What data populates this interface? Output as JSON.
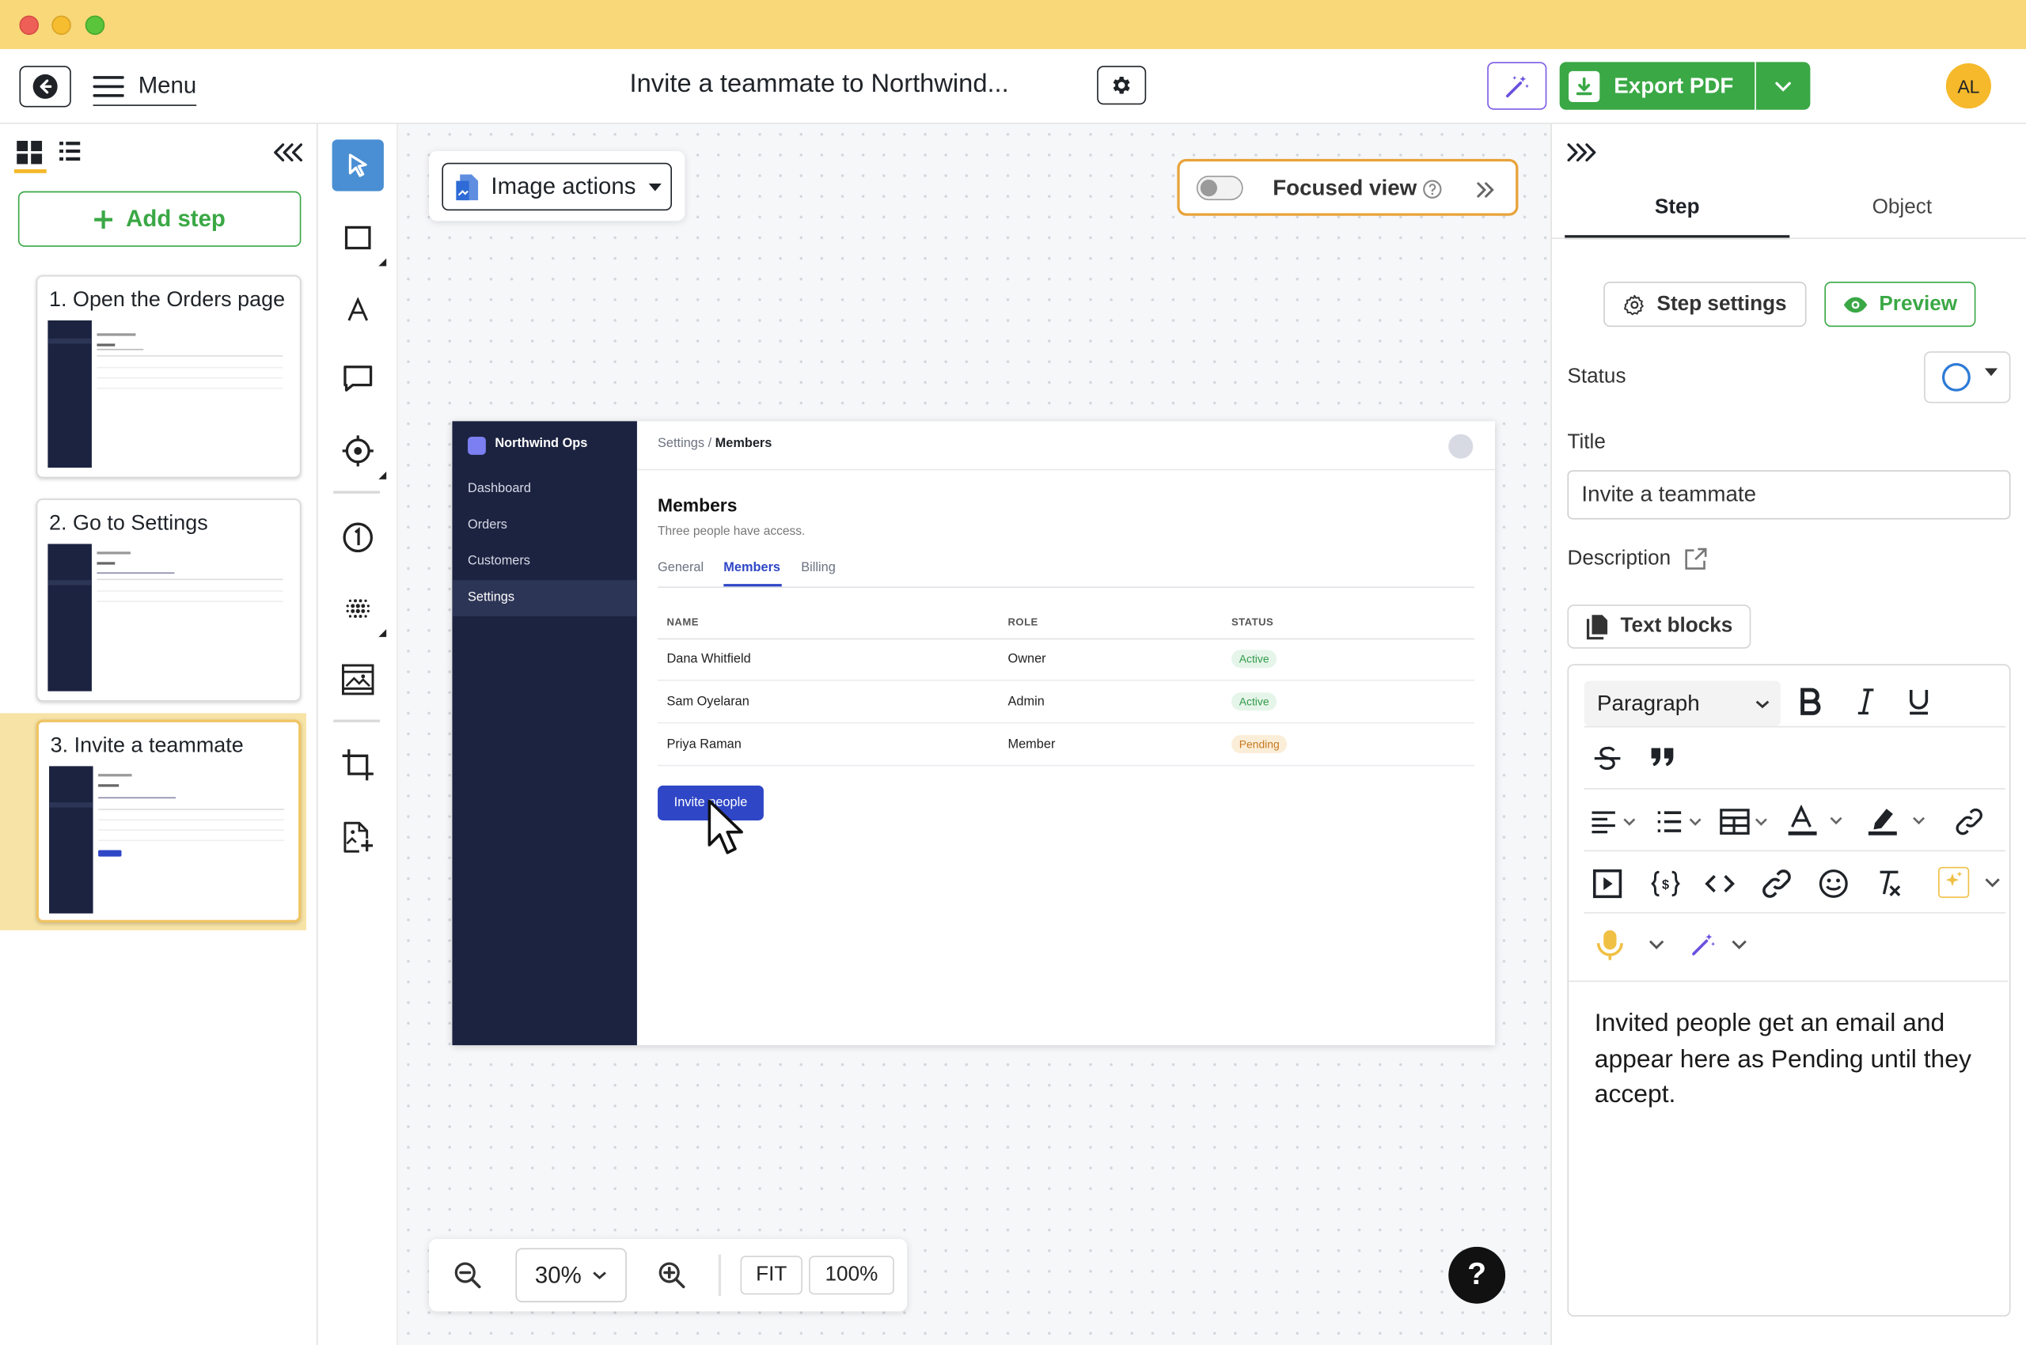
{
  "header": {
    "menu_label": "Menu",
    "doc_title": "Invite a teammate to Northwind...",
    "export_label": "Export PDF",
    "avatar_initials": "AL"
  },
  "left_panel": {
    "add_step_label": "Add step",
    "steps": [
      {
        "label": "1. Open the Orders page"
      },
      {
        "label": "2. Go to Settings"
      },
      {
        "label": "3. Invite a teammate"
      }
    ]
  },
  "canvas": {
    "image_actions_label": "Image actions",
    "focused_view_label": "Focused view",
    "zoom_value": "30%",
    "fit_label": "FIT",
    "hundred_label": "100%",
    "help_label": "?"
  },
  "screenshot": {
    "brand": "Northwind Ops",
    "nav": [
      "Dashboard",
      "Orders",
      "Customers",
      "Settings"
    ],
    "breadcrumb_parent": "Settings /",
    "breadcrumb_current": "Members",
    "heading": "Members",
    "subheading": "Three people have access.",
    "tabs": [
      "General",
      "Members",
      "Billing"
    ],
    "columns": [
      "NAME",
      "ROLE",
      "STATUS"
    ],
    "rows": [
      {
        "name": "Dana Whitfield",
        "role": "Owner",
        "status": "Active"
      },
      {
        "name": "Sam Oyelaran",
        "role": "Admin",
        "status": "Active"
      },
      {
        "name": "Priya Raman",
        "role": "Member",
        "status": "Pending"
      }
    ],
    "invite_button": "Invite people"
  },
  "right_panel": {
    "tab_step": "Step",
    "tab_object": "Object",
    "step_settings_label": "Step settings",
    "preview_label": "Preview",
    "status_label": "Status",
    "title_label": "Title",
    "title_value": "Invite a teammate",
    "description_label": "Description",
    "text_blocks_label": "Text blocks",
    "paragraph_select": "Paragraph",
    "body_text": "Invited people get an email and appear here as Pending until they accept."
  },
  "colors": {
    "titlebar": "#f8d878",
    "accent_green": "#3aa845",
    "accent_blue": "#2e7bd6",
    "selected_step_bg": "#f7e3a6",
    "focused_border": "#e8a33a",
    "screenshot_sidebar": "#1c2340",
    "invite_button": "#2f46c6"
  }
}
